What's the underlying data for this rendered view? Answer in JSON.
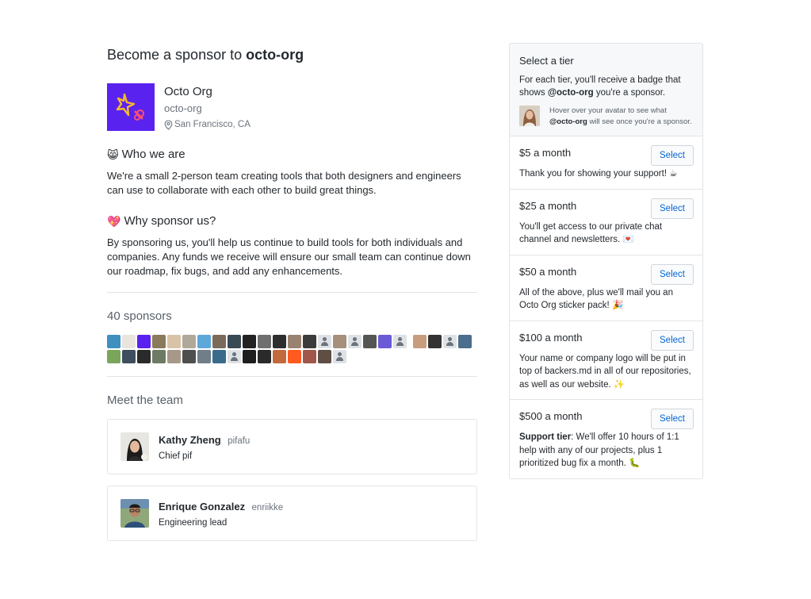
{
  "header": {
    "title_prefix": "Become a sponsor to",
    "title_org": "octo-org"
  },
  "org": {
    "name": "Octo Org",
    "login": "octo-org",
    "location": "San Francisco, CA",
    "logo_color": "#5a22ef"
  },
  "about": {
    "who_emoji": "😸",
    "who_heading": "Who we are",
    "who_text": "We're a small 2-person team creating tools that both designers and engineers can use to collaborate with each other to build great things.",
    "why_emoji": "💖",
    "why_heading": "Why sponsor us?",
    "why_text": "By sponsoring us, you'll help us continue to build tools for both individuals and companies. Any funds we receive will ensure our small team can continue down our roadmap, fix bugs, and add any enhancements."
  },
  "sponsors": {
    "heading": "40 sponsors",
    "avatars": [
      "#3f8fbf",
      "#e9e4de",
      "#5a22ef",
      "#8a7a5c",
      "#d9c3a8",
      "#b0a89a",
      "#5ea7d9",
      "#7b6a5a",
      "#3a4a55",
      "#222222",
      "#6f6f6f",
      "#2e2e2e",
      "#9a8270",
      "#3c3c3c",
      "default",
      "#a68f7b",
      "default",
      "#555555",
      "#6b5ad6",
      "default",
      "#c79d7e",
      "#333333",
      "default",
      "#4a6e8c",
      "#7aa65c",
      "#3e4e5e",
      "#2a2a2a",
      "#6f7a64",
      "#a89888",
      "#4e4e4e",
      "#707e8a",
      "#3a6b8a",
      "default",
      "#1e1e1e",
      "#2a2a2a",
      "#c26a3c",
      "#ff5a1f",
      "#a0564a",
      "#5e4e44",
      "default"
    ]
  },
  "team": {
    "heading": "Meet the team",
    "members": [
      {
        "name": "Kathy Zheng",
        "login": "pifafu",
        "role": "Chief pif"
      },
      {
        "name": "Enrique Gonzalez",
        "login": "enriikke",
        "role": "Engineering lead"
      }
    ]
  },
  "tiers": {
    "heading": "Select a tier",
    "intro_prefix": "For each tier, you'll receive a badge that shows",
    "intro_org": "@octo-org",
    "intro_suffix": "you're a sponsor.",
    "hint_prefix": "Hover over your avatar to see what",
    "hint_org": "@octo-org",
    "hint_suffix": "will see once you're a sponsor.",
    "select_label": "Select",
    "items": [
      {
        "price": "$5 a month",
        "desc": "Thank you for showing your support! ☕"
      },
      {
        "price": "$25 a month",
        "desc": "You'll get access to our private chat channel and newsletters. 💌"
      },
      {
        "price": "$50 a month",
        "desc": "All of the above, plus we'll mail you an Octo Org sticker pack! 🎉"
      },
      {
        "price": "$100 a month",
        "desc": "Your name or company logo will be put in top of backers.md in all of our repositories, as well as our website. ✨"
      },
      {
        "price": "$500 a month",
        "desc_strong": "Support tier",
        "desc": ": We'll offer 10 hours of 1:1 help with any of our projects, plus 1 prioritized bug fix a month. 🐛"
      }
    ]
  }
}
